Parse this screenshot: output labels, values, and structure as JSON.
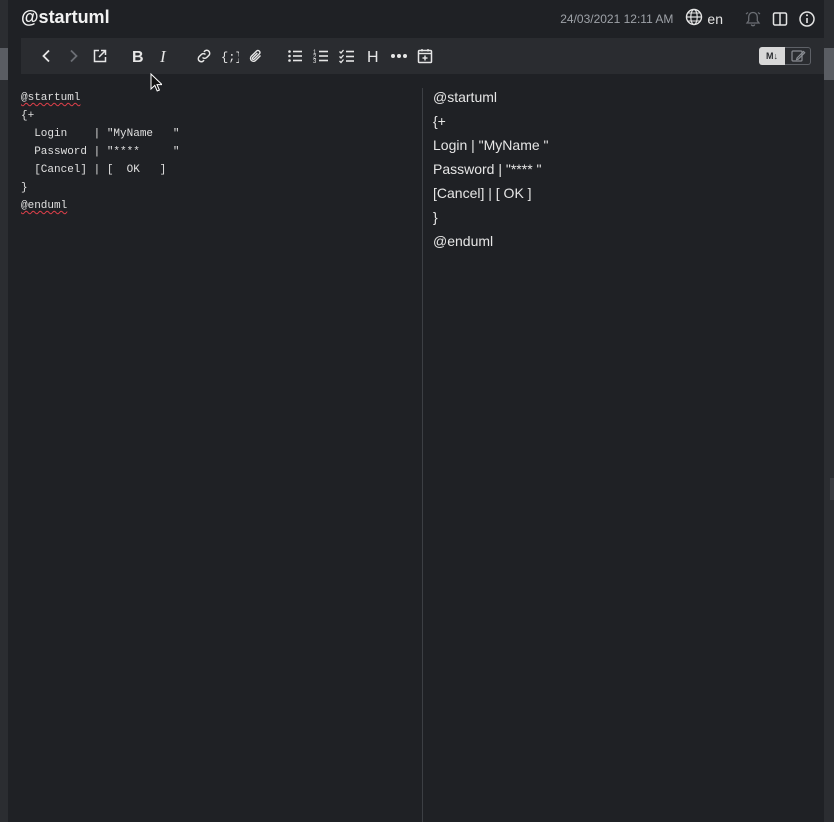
{
  "note": {
    "title": "@startuml",
    "date": "24/03/2021 12:11 AM",
    "language": "en",
    "header_icons": [
      "globe-icon",
      "bell-icon",
      "split-view-icon",
      "info-icon"
    ]
  },
  "toolbar": {
    "buttons": [
      "back-icon",
      "forward-icon",
      "open-external-icon",
      "bold-icon",
      "italic-icon",
      "link-icon",
      "code-icon",
      "attachment-icon",
      "bullet-list-icon",
      "numbered-list-icon",
      "checklist-icon",
      "heading-icon",
      "more-icon",
      "insert-date-icon"
    ],
    "heading_label": "H",
    "mode_label": "M↓"
  },
  "editor": {
    "lines": [
      "@startuml",
      "{+",
      "  Login    | \"MyName   \"",
      "  Password | \"****     \"",
      "  [Cancel] | [  OK   ]",
      "}",
      "@enduml"
    ]
  },
  "preview": {
    "lines": [
      "@startuml",
      "{+",
      "Login | \"MyName \"",
      "Password | \"**** \"",
      "[Cancel] | [ OK ]",
      "}",
      "@enduml"
    ]
  },
  "colors": {
    "background": "#1f2125",
    "toolbar": "#2a2c30",
    "text": "#e0e0e0",
    "muted": "#9ea2a8",
    "spell_error": "#e0404a"
  }
}
